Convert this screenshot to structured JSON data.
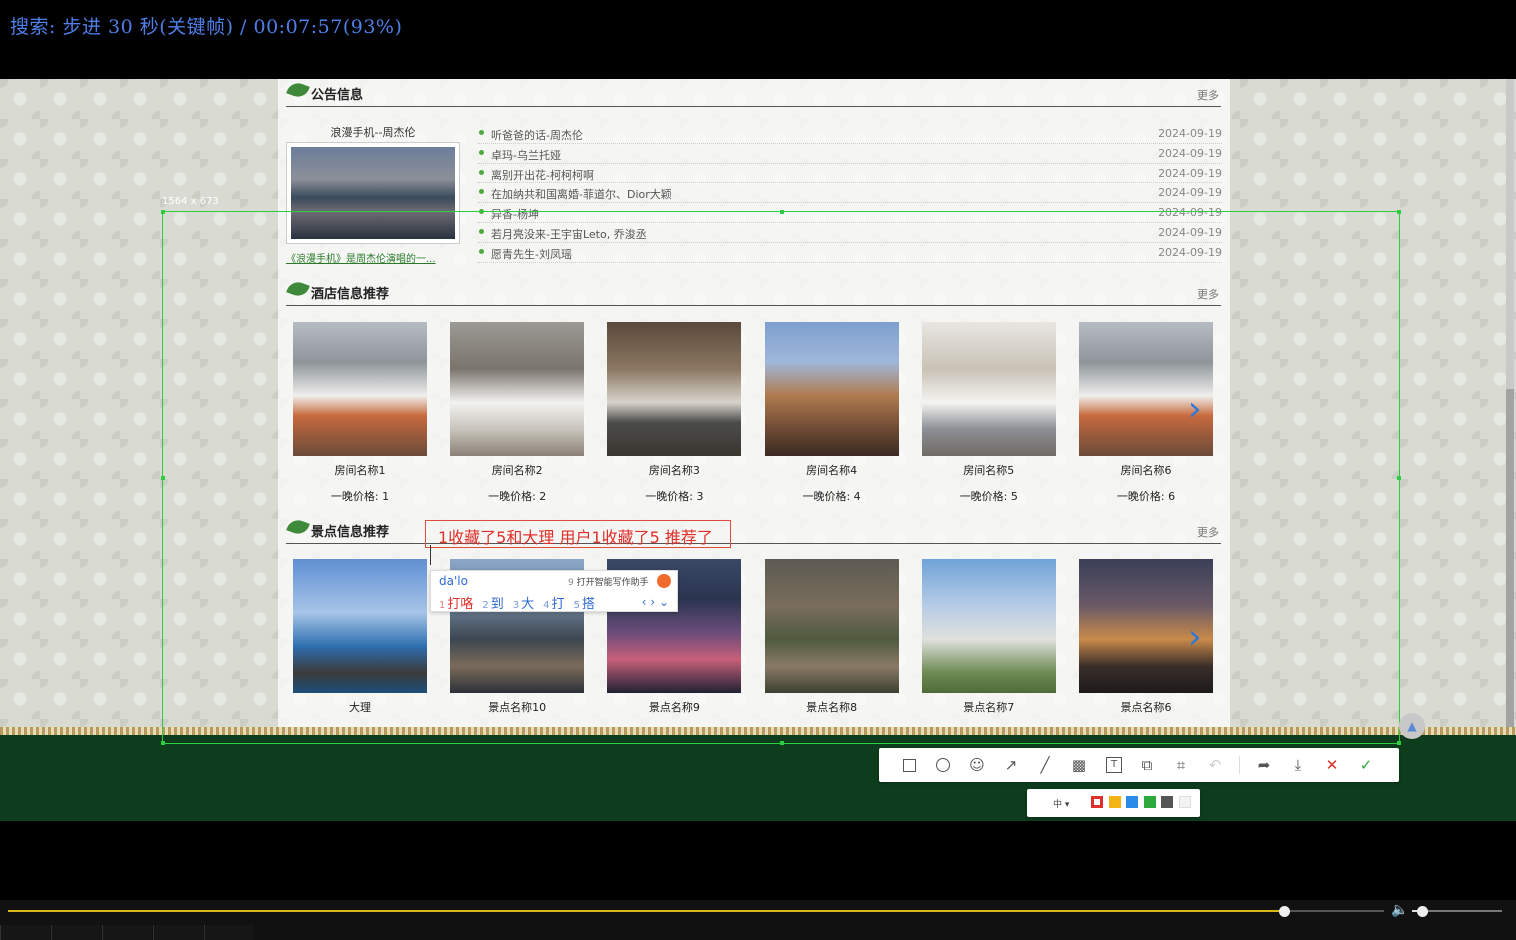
{
  "player": {
    "osd": "搜索: 步进 30 秒(关键帧) / 00:07:57(93%)",
    "progress_fraction": 0.93,
    "volume_fraction": 0.1
  },
  "notice": {
    "title": "公告信息",
    "more": "更多",
    "feature_caption": "浪漫手机--周杰伦",
    "feature_link": "《浪漫手机》是周杰伦演唱的一...",
    "items": [
      {
        "text": "听爸爸的话-周杰伦",
        "date": "2024-09-19"
      },
      {
        "text": "卓玛-乌兰托娅",
        "date": "2024-09-19"
      },
      {
        "text": "离别开出花-柯柯柯啊",
        "date": "2024-09-19"
      },
      {
        "text": "在加纳共和国离婚-菲道尔、Dior大颖",
        "date": "2024-09-19"
      },
      {
        "text": "异香-杨坤",
        "date": "2024-09-19"
      },
      {
        "text": "若月亮没来-王宇宙Leto, 乔浚丞",
        "date": "2024-09-19"
      },
      {
        "text": "愿青先生-刘凤瑶",
        "date": "2024-09-19"
      }
    ]
  },
  "hotels": {
    "title": "酒店信息推荐",
    "more": "更多",
    "items": [
      {
        "name": "房间名称1",
        "price": "一晚价格: 1"
      },
      {
        "name": "房间名称2",
        "price": "一晚价格: 2"
      },
      {
        "name": "房间名称3",
        "price": "一晚价格: 3"
      },
      {
        "name": "房间名称4",
        "price": "一晚价格: 4"
      },
      {
        "name": "房间名称5",
        "price": "一晚价格: 5"
      },
      {
        "name": "房间名称6",
        "price": "一晚价格: 6"
      }
    ]
  },
  "spots": {
    "title": "景点信息推荐",
    "more": "更多",
    "items": [
      {
        "name": "大理"
      },
      {
        "name": "景点名称10"
      },
      {
        "name": "景点名称9"
      },
      {
        "name": "景点名称8"
      },
      {
        "name": "景点名称7"
      },
      {
        "name": "景点名称6"
      }
    ]
  },
  "capture": {
    "size_label": "1564 x 673",
    "annotation_text": "1收藏了5和大理  用户1收藏了5  推荐了",
    "ime": {
      "composition": "da'lo",
      "hint_num": "9",
      "hint": "打开智能写作助手",
      "candidates": [
        {
          "n": "1",
          "text": "打咯"
        },
        {
          "n": "2",
          "text": "到"
        },
        {
          "n": "3",
          "text": "大"
        },
        {
          "n": "4",
          "text": "打"
        },
        {
          "n": "5",
          "text": "搭"
        }
      ]
    },
    "font_size_label": "中",
    "colors": [
      "#e0302a",
      "#f2b515",
      "#2b8be6",
      "#2eaa3c",
      "#555555",
      "#f3f3f3"
    ],
    "tools": [
      "rectangle-icon",
      "ellipse-icon",
      "mosaic-emoji-icon",
      "arrow-icon",
      "pen-icon",
      "blur-icon",
      "text-icon",
      "pin-icon",
      "ocr-icon",
      "undo-icon",
      "share-icon",
      "save-icon",
      "cancel-icon",
      "confirm-icon"
    ]
  }
}
